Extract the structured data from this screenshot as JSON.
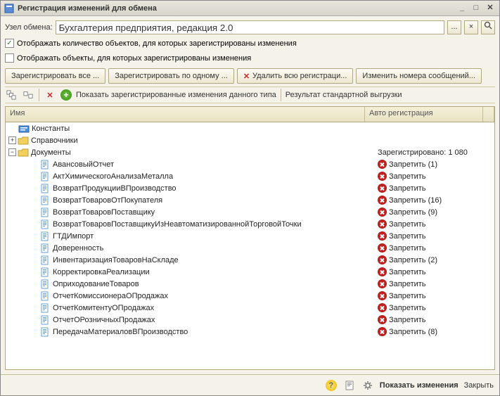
{
  "window": {
    "title": "Регистрация изменений для обмена"
  },
  "node_field": {
    "label": "Узел обмена:",
    "value": "Бухгалтерия предприятия, редакция 2.0",
    "ellipsis": "...",
    "clear": "×"
  },
  "checkboxes": {
    "show_count": {
      "label": "Отображать количество объектов, для которых зарегистрированы изменения",
      "checked": true
    },
    "show_objects": {
      "label": "Отображать объекты, для которых зарегистрированы изменения",
      "checked": false
    }
  },
  "buttons": {
    "register_all": "Зарегистрировать все ...",
    "register_one": "Зарегистрировать по одному ...",
    "delete_reg": "Удалить всю регистраци...",
    "change_msg": "Изменить номера сообщений..."
  },
  "toolbar2": {
    "show_registered": "Показать зарегистрированные изменения данного типа",
    "result_export": "Результат стандартной выгрузки"
  },
  "tree": {
    "headers": {
      "name": "Имя",
      "autoreg": "Авто регистрация"
    },
    "root": {
      "constants": "Константы",
      "references": "Справочники",
      "documents": "Документы",
      "documents_reg": "Зарегистрировано: 1 080"
    },
    "docs": [
      {
        "label": "АвансовыйОтчет",
        "reg": "Запретить (1)"
      },
      {
        "label": "АктХимическогоАнализаМеталла",
        "reg": "Запретить"
      },
      {
        "label": "ВозвратПродукцииВПроизводство",
        "reg": "Запретить"
      },
      {
        "label": "ВозвратТоваровОтПокупателя",
        "reg": "Запретить (16)"
      },
      {
        "label": "ВозвратТоваровПоставщику",
        "reg": "Запретить (9)"
      },
      {
        "label": "ВозвратТоваровПоставщикуИзНеавтоматизированнойТорговойТочки",
        "reg": "Запретить"
      },
      {
        "label": "ГТДИмпорт",
        "reg": "Запретить"
      },
      {
        "label": "Доверенность",
        "reg": "Запретить"
      },
      {
        "label": "ИнвентаризацияТоваровНаСкладе",
        "reg": "Запретить (2)"
      },
      {
        "label": "КорректировкаРеализации",
        "reg": "Запретить"
      },
      {
        "label": "ОприходованиеТоваров",
        "reg": "Запретить"
      },
      {
        "label": "ОтчетКомиссионераОПродажах",
        "reg": "Запретить"
      },
      {
        "label": "ОтчетКомитентуОПродажах",
        "reg": "Запретить"
      },
      {
        "label": "ОтчетОРозничныхПродажах",
        "reg": "Запретить"
      },
      {
        "label": "ПередачаМатериаловВПроизводство",
        "reg": "Запретить (8)"
      }
    ]
  },
  "footer": {
    "main_action": "Показать изменения",
    "close": "Закрыть"
  }
}
